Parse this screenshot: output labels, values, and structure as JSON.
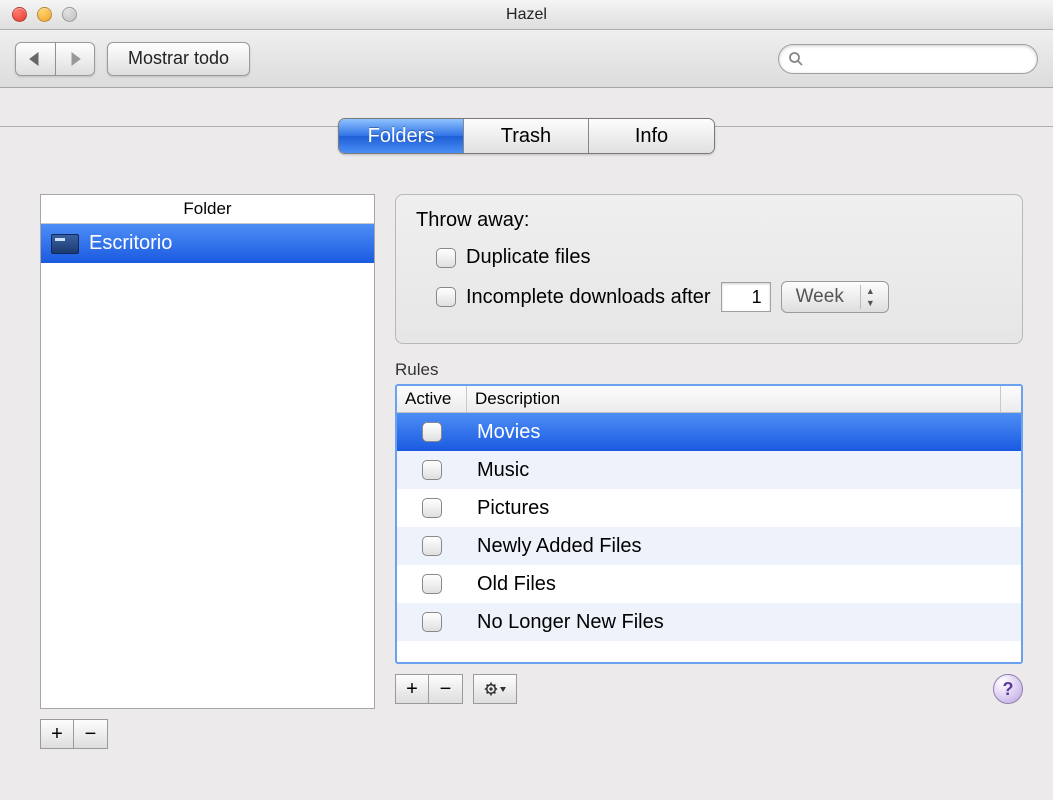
{
  "window": {
    "title": "Hazel"
  },
  "toolbar": {
    "show_all": "Mostrar todo",
    "search_placeholder": ""
  },
  "tabs": {
    "folders": "Folders",
    "trash": "Trash",
    "info": "Info",
    "active": "folders"
  },
  "folder_panel": {
    "header": "Folder",
    "items": [
      {
        "name": "Escritorio",
        "selected": true
      }
    ]
  },
  "throw_away": {
    "title": "Throw away:",
    "duplicate_label": "Duplicate files",
    "incomplete_label": "Incomplete downloads after",
    "incomplete_value": "1",
    "incomplete_unit": "Week"
  },
  "rules": {
    "label": "Rules",
    "col_active": "Active",
    "col_description": "Description",
    "items": [
      {
        "desc": "Movies",
        "active": false,
        "selected": true
      },
      {
        "desc": "Music",
        "active": false,
        "selected": false
      },
      {
        "desc": "Pictures",
        "active": false,
        "selected": false
      },
      {
        "desc": "Newly Added Files",
        "active": false,
        "selected": false
      },
      {
        "desc": "Old Files",
        "active": false,
        "selected": false
      },
      {
        "desc": "No Longer New Files",
        "active": false,
        "selected": false
      }
    ]
  },
  "buttons": {
    "plus": "+",
    "minus": "−",
    "help": "?"
  }
}
